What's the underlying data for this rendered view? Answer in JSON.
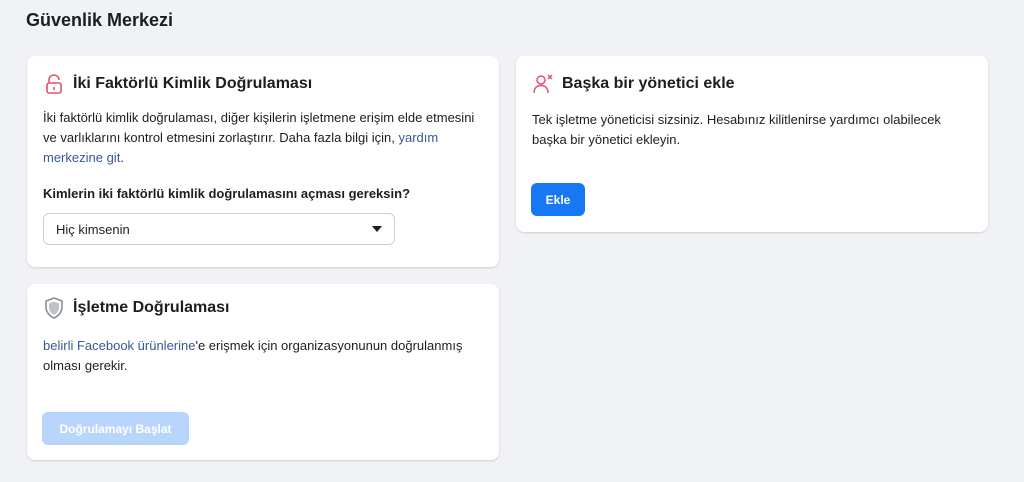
{
  "page": {
    "title": "Güvenlik Merkezi"
  },
  "two_factor": {
    "icon": "lock-icon",
    "title": "İki Faktörlü Kimlik Doğrulaması",
    "description": "İki faktörlü kimlik doğrulaması, diğer kişilerin işletmene erişim elde etmesini ve varlıklarını kontrol etmesini zorlaştırır. Daha fazla bilgi için, ",
    "link_text": "yardım merkezine git",
    "link_suffix": ".",
    "question": "Kimlerin iki faktörlü kimlik doğrulamasını açması gereksin?",
    "select_value": "Hiç kimsenin"
  },
  "business_verification": {
    "icon": "shield-icon",
    "title": "İşletme Doğrulaması",
    "link_text": "belirli Facebook ürünlerine",
    "description": "'e erişmek için organizasyonunun doğrulanmış olması gerekir.",
    "button_label": "Doğrulamayı Başlat"
  },
  "add_admin": {
    "icon": "add-person-icon",
    "title": "Başka bir yönetici ekle",
    "description": "Tek işletme yöneticisi sizsiniz. Hesabınız kilitlenirse yardımcı olabilecek başka bir yönetici ekleyin.",
    "button_label": "Ekle"
  },
  "colors": {
    "background": "#f0f2f5",
    "primary": "#1877f2",
    "primary_disabled": "#b8d6fb",
    "link": "#385898",
    "lock_icon": "#e4526a"
  }
}
